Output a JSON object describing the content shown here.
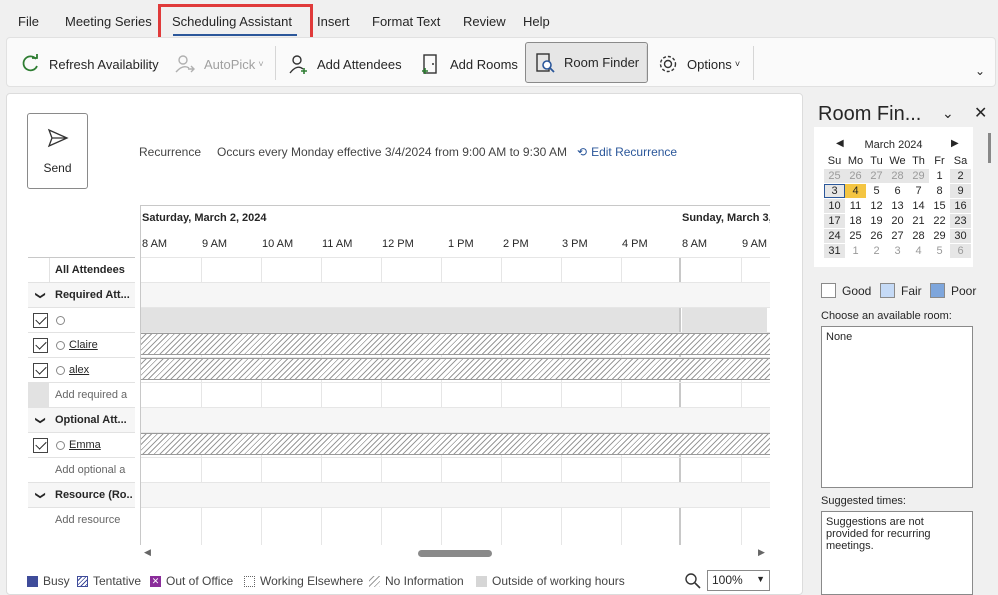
{
  "menu": {
    "items": [
      "File",
      "Meeting Series",
      "Scheduling Assistant",
      "Insert",
      "Format Text",
      "Review",
      "Help"
    ],
    "active": "Scheduling Assistant"
  },
  "ribbon": {
    "refresh": "Refresh Availability",
    "autopick": "AutoPick",
    "add_attendees": "Add Attendees",
    "add_rooms": "Add Rooms",
    "room_finder": "Room Finder",
    "options": "Options"
  },
  "send": {
    "label": "Send"
  },
  "recurrence": {
    "label": "Recurrence",
    "text": "Occurs every Monday effective 3/4/2024 from 9:00 AM to 9:30 AM",
    "edit": "Edit Recurrence"
  },
  "schedule": {
    "day1": "Saturday, March 2, 2024",
    "day2": "Sunday, March 3,",
    "times_day1": [
      "8 AM",
      "9 AM",
      "10 AM",
      "11 AM",
      "12 PM",
      "1 PM",
      "2 PM",
      "3 PM",
      "4 PM"
    ],
    "times_day2": [
      "8 AM",
      "9 AM"
    ]
  },
  "attendees": {
    "header": "All Attendees",
    "required_group": "Required Att...",
    "required": [
      "",
      "Claire",
      "alex"
    ],
    "add_required": "Add required a",
    "optional_group": "Optional Att...",
    "optional": [
      "Emma"
    ],
    "add_optional": "Add optional a",
    "resource_group": "Resource (Ro...",
    "add_resource": "Add resource"
  },
  "legend": {
    "busy": "Busy",
    "tentative": "Tentative",
    "ooo": "Out of Office",
    "elsewhere": "Working Elsewhere",
    "noinfo": "No Information",
    "outside": "Outside of working hours"
  },
  "zoom": "100%",
  "room_finder": {
    "title": "Room Fin...",
    "month": "March 2024",
    "weekdays": [
      "Su",
      "Mo",
      "Tu",
      "We",
      "Th",
      "Fr",
      "Sa"
    ],
    "weeks": [
      [
        "25",
        "26",
        "27",
        "28",
        "29",
        "1",
        "2"
      ],
      [
        "3",
        "4",
        "5",
        "6",
        "7",
        "8",
        "9"
      ],
      [
        "10",
        "11",
        "12",
        "13",
        "14",
        "15",
        "16"
      ],
      [
        "17",
        "18",
        "19",
        "20",
        "21",
        "22",
        "23"
      ],
      [
        "24",
        "25",
        "26",
        "27",
        "28",
        "29",
        "30"
      ],
      [
        "31",
        "1",
        "2",
        "3",
        "4",
        "5",
        "6"
      ]
    ],
    "good": "Good",
    "fair": "Fair",
    "poor": "Poor",
    "choose_label": "Choose an available room:",
    "room_value": "None",
    "suggested_label": "Suggested times:",
    "suggested_text": "Suggestions are not provided for recurring meetings.",
    "colors": {
      "good": "#ffffff",
      "fair": "#c5daf6",
      "poor": "#7ea6dc",
      "today": "#f4c542",
      "selected_border": "#2b579a"
    }
  }
}
